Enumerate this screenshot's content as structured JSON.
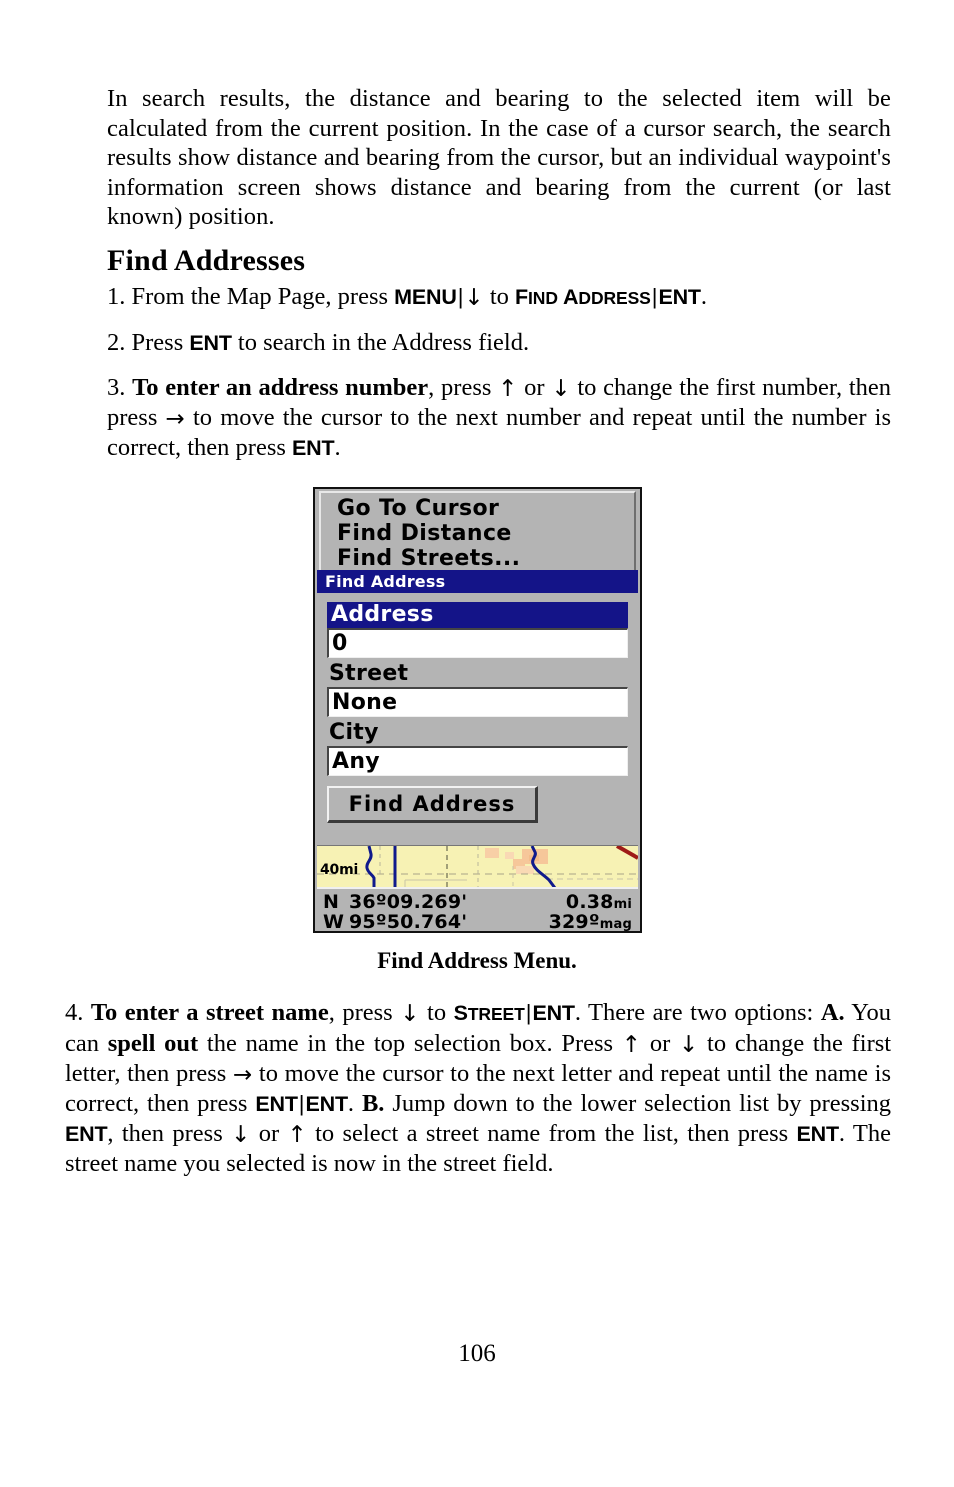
{
  "page": {
    "number": "106"
  },
  "intro": {
    "text": "In search results, the distance and bearing to the selected item will be calculated from the current position. In the case of a cursor search, the search results show distance and bearing from the cursor, but an individual waypoint's information screen shows distance and bearing from the current (or last known) position."
  },
  "heading": {
    "title": "Find Addresses"
  },
  "steps": {
    "step1": {
      "number": "1.",
      "t1": "From the Map Page, press",
      "key_menu": "MENU",
      "sep1": "|",
      "arrow_down": "↓",
      "t2": "to",
      "menu_find": "Find Address",
      "menu_find_cap1": "F",
      "menu_find_sc1": "IND",
      "menu_find_cap2": "A",
      "menu_find_sc2": "DDRESS",
      "sep2": "|",
      "key_ent": "ENT",
      "t3": "."
    },
    "step2": {
      "number": "2.",
      "t1": "Press",
      "key_ent": "ENT",
      "t2": "to search in the Address field."
    },
    "step3": {
      "number": "3.",
      "bold_lead": "To enter an address number",
      "t1": ", press",
      "arrow_up": "↑",
      "t2": "or",
      "arrow_down": "↓",
      "t3": "to change the first number, then press",
      "arrow_right": "→",
      "t4": "to move the cursor to the next number and repeat until the number is correct, then press",
      "key_ent": "ENT",
      "t5": "."
    },
    "step4": {
      "number": "4.",
      "bold_lead": "To enter a street name",
      "t1": ", press",
      "arrow_down": "↓",
      "t2": "to",
      "menu_street_cap": "S",
      "menu_street_sc": "TREET",
      "sep1": "|",
      "key_ent1": "ENT",
      "t3": ". There are two options:",
      "label_a": "A.",
      "t4": "You can",
      "bold_spell": "spell out",
      "t5": "the name in the top selection box. Press",
      "arrow_up": "↑",
      "t6": "or",
      "arrow_down2": "↓",
      "t7": "to change the first letter, then press",
      "arrow_right": "→",
      "t8": "to move the cursor to the next letter and repeat until the name is correct, then press",
      "key_ent2": "ENT",
      "sep2": "|",
      "key_ent3": "ENT",
      "t9": ".",
      "label_b": "B.",
      "t10": "Jump down to the lower selection list by pressing",
      "key_ent4": "ENT",
      "t11": ", then press",
      "arrow_down3": "↓",
      "t12": "or",
      "arrow_up2": "↑",
      "t13": "to select a street name from the list, then press",
      "key_ent5": "ENT",
      "t14": ". The street name you selected is now in the street field."
    }
  },
  "figure": {
    "caption": "Find Address Menu.",
    "device": {
      "menu_items": [
        "Go To Cursor",
        "Find Distance",
        "Find Streets..."
      ],
      "dialog_title": "Find Address",
      "fields": [
        {
          "label": "Address",
          "value": "0",
          "selected": true
        },
        {
          "label": "Street",
          "value": "None",
          "selected": false
        },
        {
          "label": "City",
          "value": "Any",
          "selected": false
        }
      ],
      "button_label": "Find Address",
      "map": {
        "scale": "40mi",
        "background_color": "#f7f2b4",
        "water_color": "#101a8c",
        "urban_color": "#f6c79a",
        "highway_color": "#9e1b17"
      },
      "coords": {
        "lat_dir": "N",
        "lat_value": "36º09.269'",
        "lon_dir": "W",
        "lon_value": "95º50.764'",
        "distance_value": "0.38",
        "distance_unit": "mi",
        "bearing_value": "329º",
        "bearing_unit": "mag"
      },
      "colors": {
        "panel": "#b4b4b4",
        "title_bar": "#141488",
        "highlight": "#141488",
        "field_bg": "#ffffff",
        "text": "#000000"
      }
    }
  }
}
